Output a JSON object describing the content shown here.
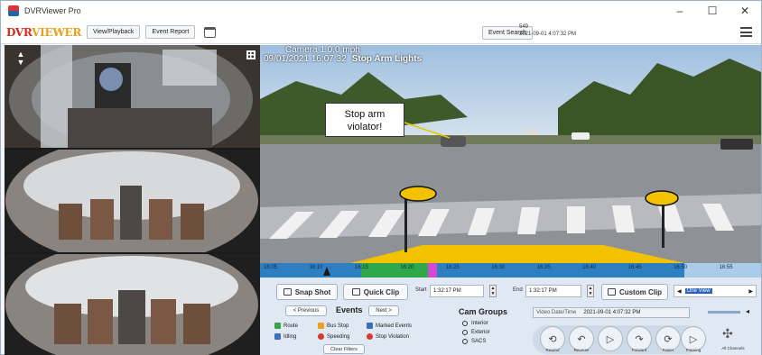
{
  "window": {
    "title": "DVRViewer Pro",
    "controls": [
      "–",
      "☐",
      "✕"
    ]
  },
  "toolbar": {
    "logo_a": "DVR",
    "logo_b": "VIEWER",
    "view_playback": "View/Playback",
    "event_report": "Event Report",
    "event_search": "Event Search",
    "bus_id": "549",
    "datetime": "2021-09-01 4:07:32 PM"
  },
  "video": {
    "overlay_camera": "Camera 1  0.0 mph",
    "overlay_datetime": "09/01/2021 16:07:32",
    "overlay_status": "Stop Arm Lights",
    "callout_line1": "Stop arm",
    "callout_line2": "violator!"
  },
  "timeline": {
    "ticks": [
      "16:05",
      "16:10",
      "16:15",
      "16:20",
      "16:25",
      "16:30",
      "16:35",
      "16:40",
      "16:45",
      "16:50",
      "16:55"
    ],
    "colors": {
      "base": "#2d7fc1",
      "event_green": "#2ea84a",
      "event_pink": "#d24ad0",
      "end_light": "#a9cde9"
    }
  },
  "controls": {
    "snap_shot": "Snap Shot",
    "quick_clip": "Quick Clip",
    "start_label": "Start",
    "start_value": "1:32:17 PM",
    "end_label": "End",
    "end_value": "1:32:17 PM",
    "custom_clip": "Custom Clip",
    "one_view": "One View",
    "previous": "< Previous",
    "events_title": "Events",
    "next": "Next >",
    "events": [
      {
        "label": "Route",
        "color": "#3ba44a"
      },
      {
        "label": "Bus Stop",
        "color": "#f0a020"
      },
      {
        "label": "Marked Events",
        "color": "#3a6fc0"
      },
      {
        "label": "Idling",
        "color": "#3a6fc0"
      },
      {
        "label": "Speeding",
        "color": "#d43a2a"
      },
      {
        "label": "Stop Violation",
        "color": "#d43a2a"
      }
    ],
    "clear_filters": "Clear Filters",
    "cam_groups_title": "Cam Groups",
    "cam_groups": [
      "Interior",
      "Exterior",
      "SACS"
    ],
    "video_datetime_label": "Video Date/Time",
    "video_datetime": "2021-09-01 4:07:32 PM",
    "playback": [
      {
        "label": "Rewind",
        "icon": "⟲"
      },
      {
        "label": "Reverse",
        "icon": "↶"
      },
      {
        "label": "",
        "icon": "▷"
      },
      {
        "label": "Forward",
        "icon": "↷"
      },
      {
        "label": "Faster",
        "icon": "⟳"
      }
    ],
    "framing": "Framing",
    "all_channels": "All Channels"
  }
}
